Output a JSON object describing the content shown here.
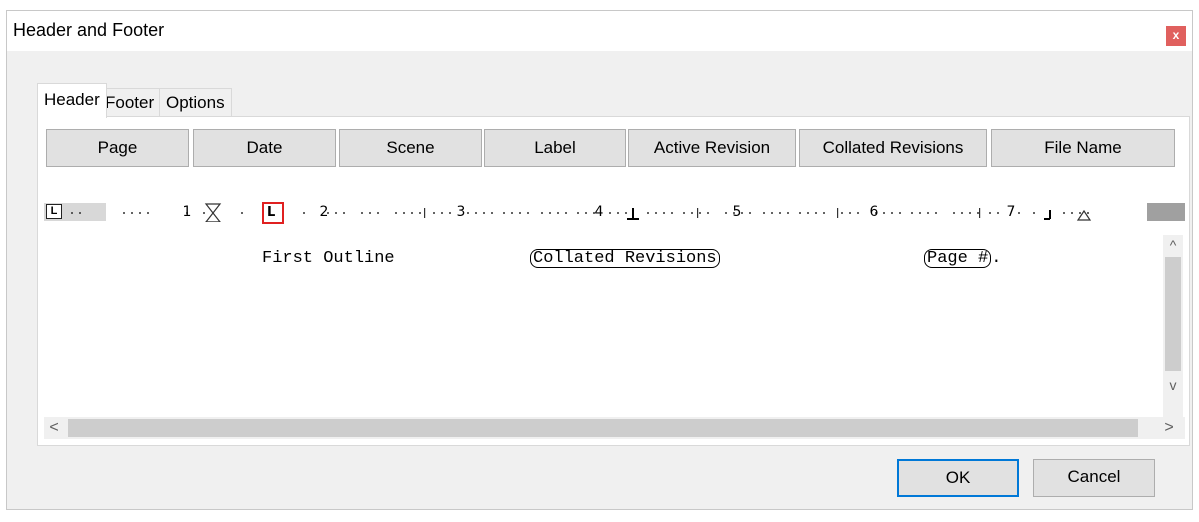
{
  "window": {
    "title": "Header and Footer",
    "close_label": "x"
  },
  "tabs": [
    {
      "label": "Header",
      "active": true
    },
    {
      "label": "Footer",
      "active": false
    },
    {
      "label": "Options",
      "active": false
    }
  ],
  "field_buttons": [
    {
      "label": "Page"
    },
    {
      "label": "Date"
    },
    {
      "label": "Scene"
    },
    {
      "label": "Label"
    },
    {
      "label": "Active Revision"
    },
    {
      "label": "Collated Revisions"
    },
    {
      "label": "File Name"
    }
  ],
  "ruler": {
    "tab_type_button": "L",
    "numbers": [
      "1",
      "2",
      "3",
      "4",
      "5",
      "6",
      "7"
    ],
    "selected_tab_stop": "L"
  },
  "editor": {
    "left_text": "First Outline",
    "center_field": "Collated Revisions",
    "right_field": "Page #",
    "right_suffix": "."
  },
  "scrollbars": {
    "up_arrow": "^",
    "down_arrow": "v",
    "left_arrow": "<",
    "right_arrow": ">"
  },
  "buttons": {
    "ok": "OK",
    "cancel": "Cancel"
  },
  "colors": {
    "close_button": "#e0605e",
    "selected_marker": "#e02020",
    "default_button_border": "#0078d7"
  }
}
